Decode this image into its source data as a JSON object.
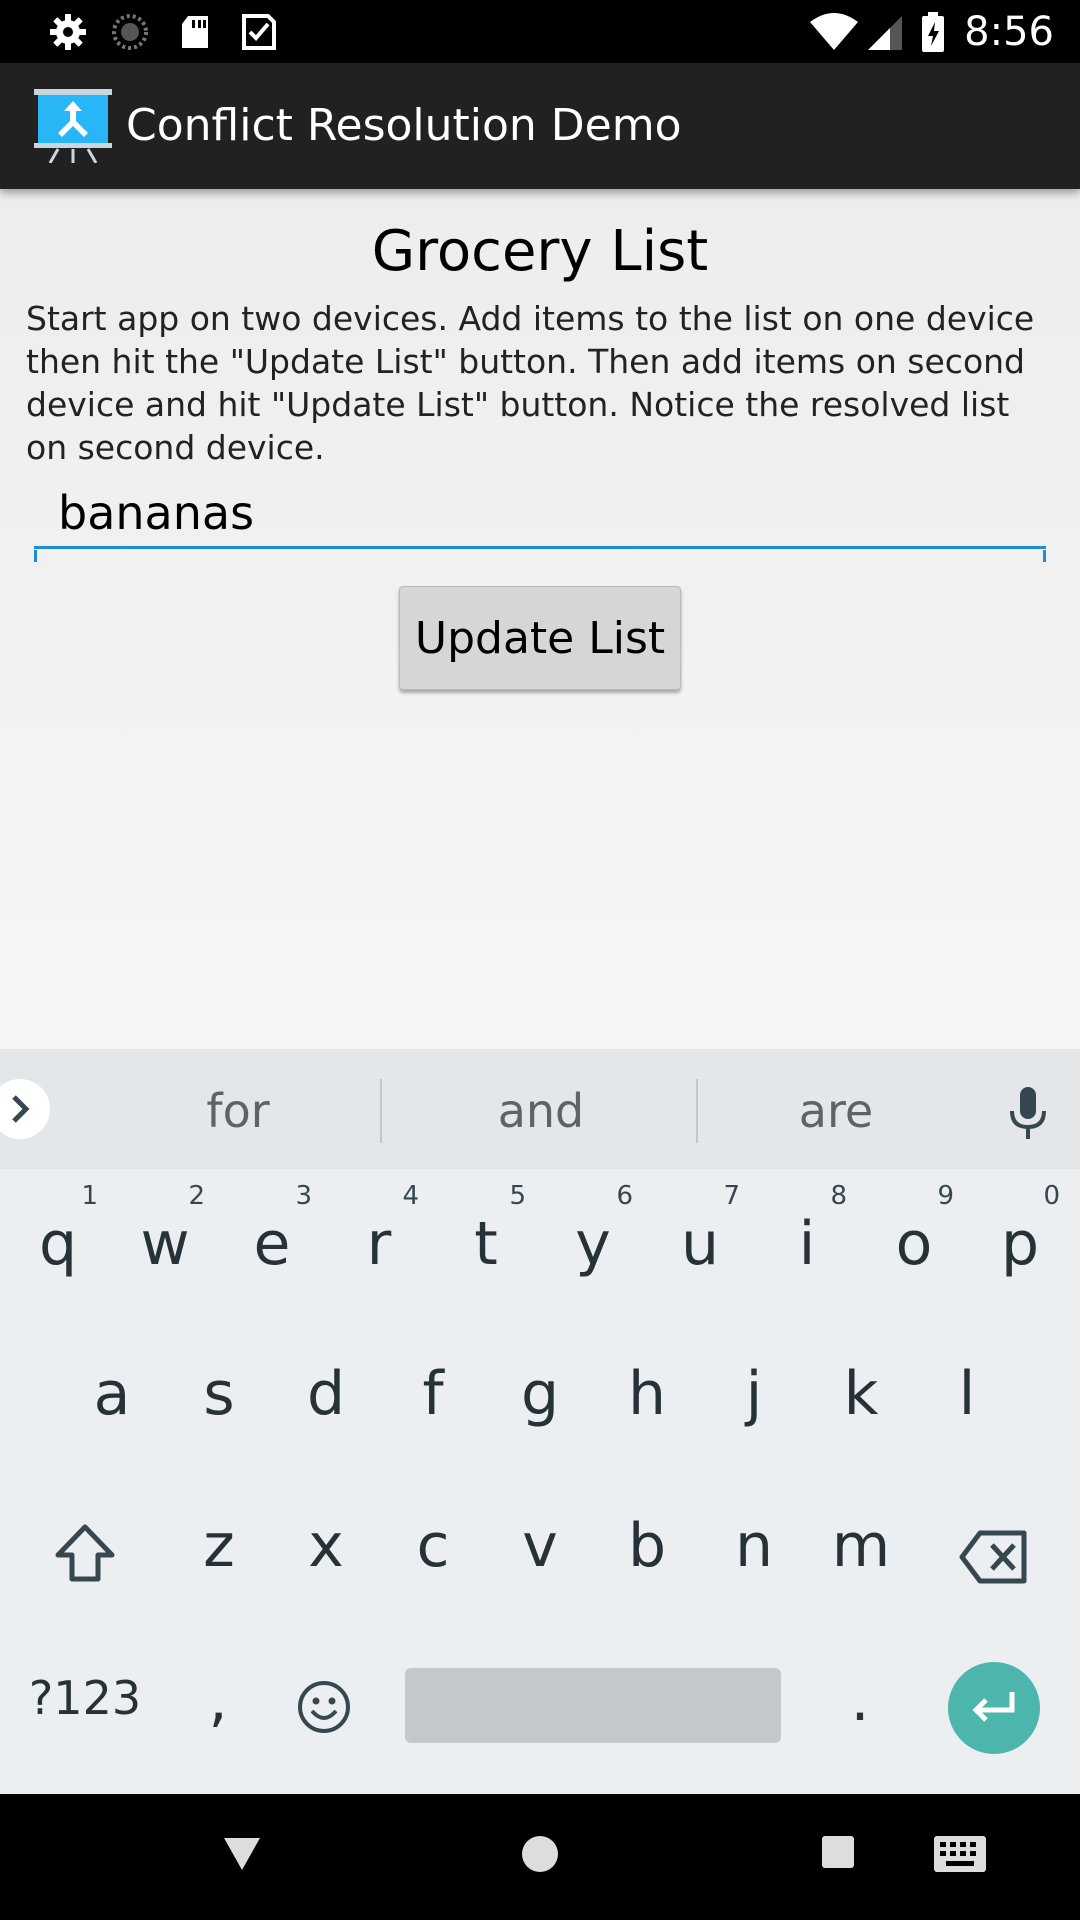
{
  "status_bar": {
    "time": "8:56",
    "left_icons": [
      "settings-icon",
      "sync-icon",
      "sd-card-icon",
      "checklist-icon"
    ],
    "right_icons": [
      "wifi-icon",
      "signal-icon",
      "battery-charging-icon"
    ]
  },
  "app_bar": {
    "title": "Conflict Resolution Demo",
    "icon": "app-logo-icon"
  },
  "main": {
    "title": "Grocery List",
    "instructions": "Start app on two devices. Add items to the list on one device then hit the \"Update List\" button. Then add items on second device and hit \"Update List\" button. Notice the resolved list on second device.",
    "item_input_value": "bananas",
    "update_button_label": "Update List"
  },
  "keyboard": {
    "suggestions": [
      "for",
      "and",
      "are"
    ],
    "row1": [
      {
        "key": "q",
        "hint": "1"
      },
      {
        "key": "w",
        "hint": "2"
      },
      {
        "key": "e",
        "hint": "3"
      },
      {
        "key": "r",
        "hint": "4"
      },
      {
        "key": "t",
        "hint": "5"
      },
      {
        "key": "y",
        "hint": "6"
      },
      {
        "key": "u",
        "hint": "7"
      },
      {
        "key": "i",
        "hint": "8"
      },
      {
        "key": "o",
        "hint": "9"
      },
      {
        "key": "p",
        "hint": "0"
      }
    ],
    "row2": [
      "a",
      "s",
      "d",
      "f",
      "g",
      "h",
      "j",
      "k",
      "l"
    ],
    "row3": [
      "z",
      "x",
      "c",
      "v",
      "b",
      "n",
      "m"
    ],
    "symbols_label": "?123",
    "comma_label": ",",
    "period_label": ".",
    "accent_color": "#4db6ac"
  },
  "nav_bar": {
    "icons": [
      "back-icon",
      "home-icon",
      "recents-icon",
      "keyboard-switch-icon"
    ]
  }
}
